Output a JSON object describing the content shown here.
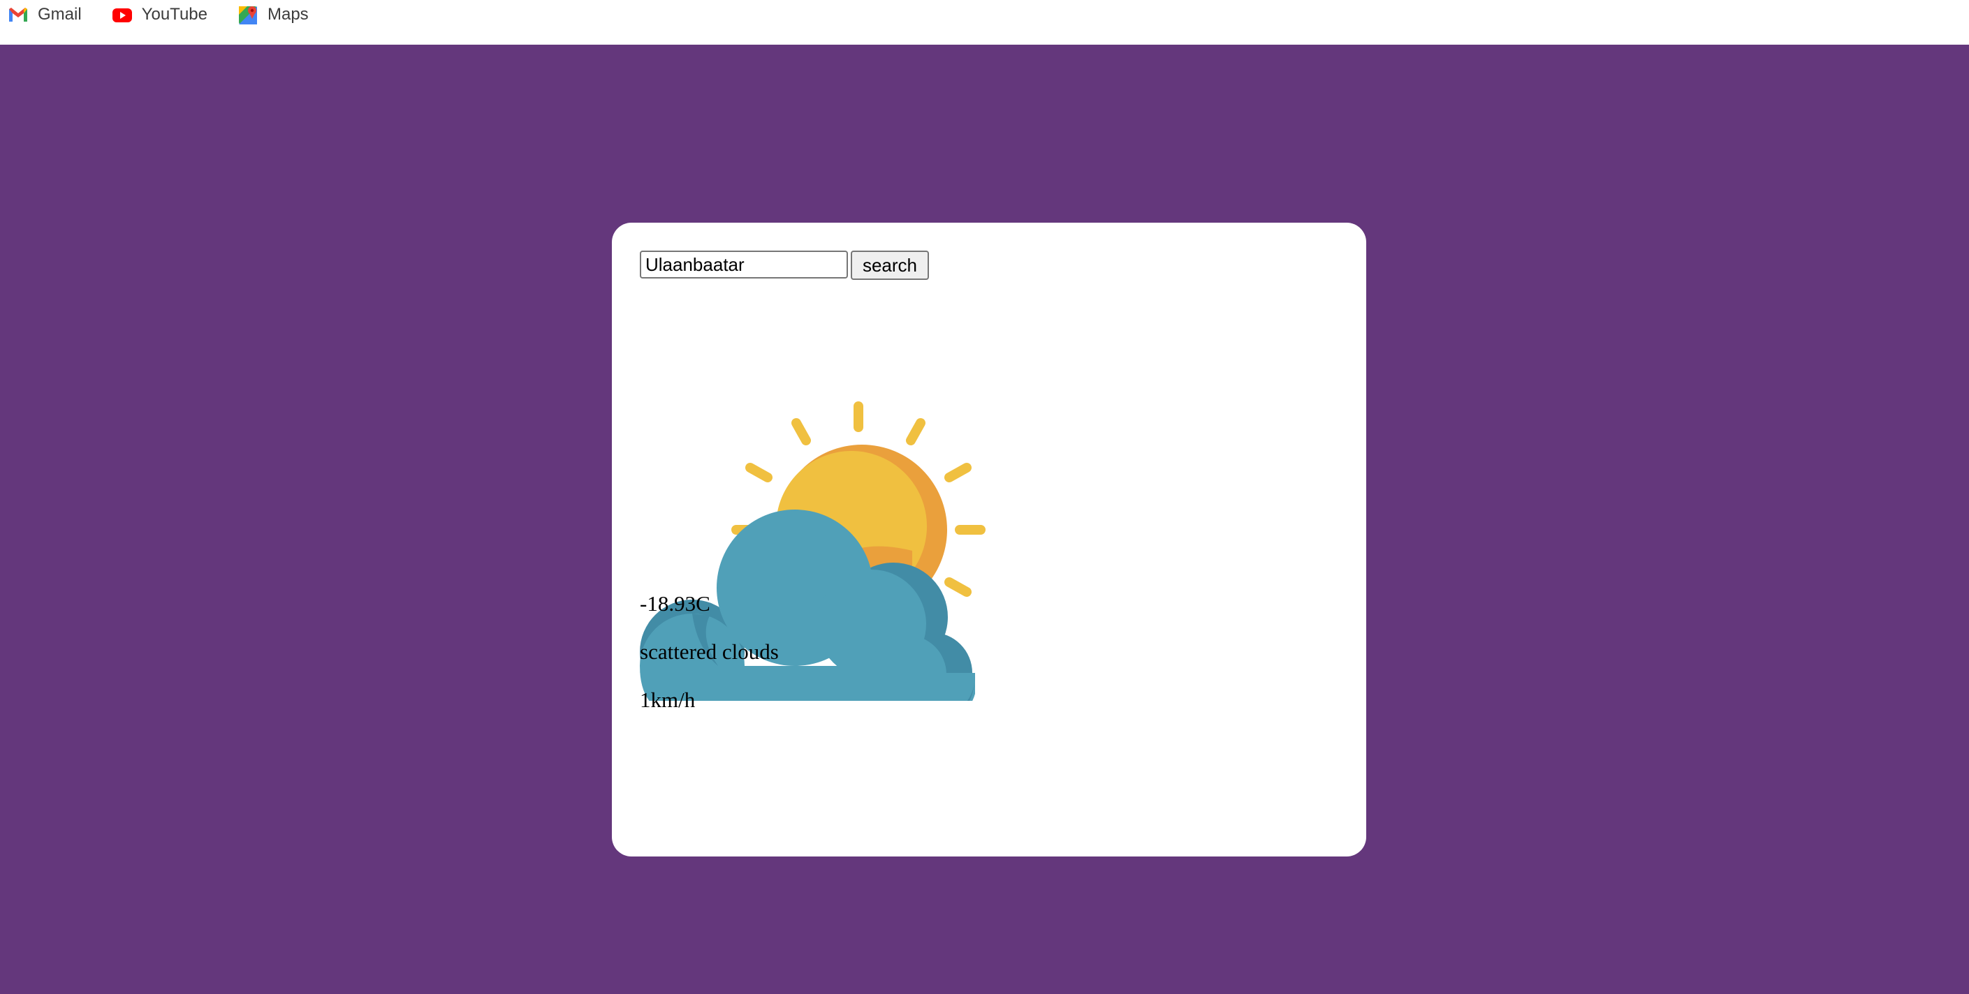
{
  "bookmarks": [
    {
      "label": "Gmail",
      "icon": "gmail-icon"
    },
    {
      "label": "YouTube",
      "icon": "youtube-icon"
    },
    {
      "label": "Maps",
      "icon": "maps-icon"
    }
  ],
  "search": {
    "value": "Ulaanbaatar",
    "button_label": "search"
  },
  "weather": {
    "icon": "sun-behind-cloud-icon",
    "temperature": "-18.93C",
    "description": "scattered clouds",
    "wind": "1km/h"
  },
  "colors": {
    "page_background": "#64377c",
    "card_background": "#ffffff",
    "sun": "#f0c040",
    "sun_shade": "#eaa03c",
    "cloud": "#50a0b8",
    "cloud_shade": "#428ca6"
  }
}
